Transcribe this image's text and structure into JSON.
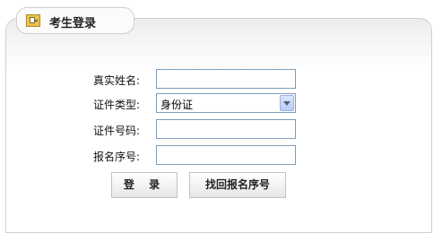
{
  "header": {
    "title": "考生登录",
    "icon": "id-card-icon"
  },
  "form": {
    "real_name_label": "真实姓名:",
    "real_name_value": "",
    "id_type_label": "证件类型:",
    "id_type_selected": "身份证",
    "id_number_label": "证件号码:",
    "id_number_value": "",
    "reg_number_label": "报名序号:",
    "reg_number_value": ""
  },
  "buttons": {
    "login_label": "登 录",
    "find_label": "找回报名序号"
  },
  "colors": {
    "input_border": "#7f9db9",
    "panel_border": "#cfcfcf",
    "select_arrow": "#b9cdf4"
  }
}
